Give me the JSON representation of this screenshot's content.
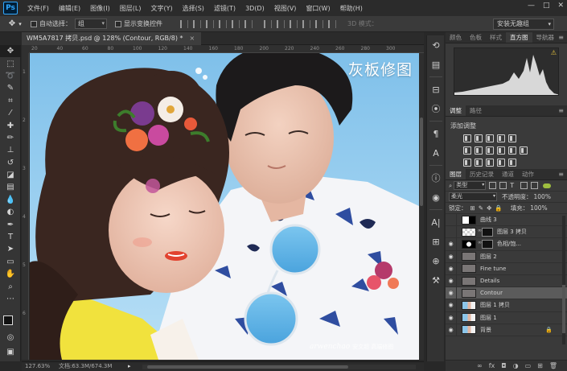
{
  "menubar": {
    "logo": "Ps",
    "items": [
      "文件(F)",
      "编辑(E)",
      "图像(I)",
      "图层(L)",
      "文字(Y)",
      "选择(S)",
      "滤镜(T)",
      "3D(D)",
      "视图(V)",
      "窗口(W)",
      "帮助(H)"
    ],
    "win_min": "—",
    "win_max": "□",
    "win_close": "✕"
  },
  "options": {
    "auto_select_label": "自动选择：",
    "auto_select_value": "组",
    "show_transform_label": "显示变换控件",
    "mode_3d_label": "3D 模式：",
    "workspace": "安装无趣组"
  },
  "document": {
    "tab_title": "WM5A7817 拷贝.psd @ 128% (Contour, RGB/8) *",
    "tab_close": "×",
    "canvas_title": "灰板修图",
    "watermark_en": "arwenchao",
    "watermark_cn": "安文超 高端修图",
    "ruler_ticks": [
      "20",
      "40",
      "60",
      "80",
      "100",
      "120",
      "140",
      "160",
      "180",
      "200",
      "220",
      "240",
      "260",
      "280",
      "300"
    ],
    "ruler_left_ticks": [
      "1",
      "2",
      "3",
      "4",
      "5",
      "6"
    ]
  },
  "status": {
    "zoom": "127.63%",
    "doc_size": "文档:63.3M/674.3M",
    "arrow": "▸"
  },
  "panels": {
    "top_tabs": [
      "颜色",
      "色板",
      "样式",
      "直方图",
      "导航器"
    ],
    "top_active": "直方图",
    "adj_tabs": [
      "调整",
      "路径"
    ],
    "adj_active": "调整",
    "adj_title": "添加调整",
    "layers_tabs": [
      "图层",
      "历史记录",
      "通道",
      "动作"
    ],
    "layers_active": "图层",
    "filter_select": "类型",
    "blend_mode": "柔光",
    "opacity_label": "不透明度：",
    "opacity_value": "100%",
    "lock_label": "锁定：",
    "fill_label": "填充：",
    "fill_value": "100%",
    "menu_icon": "≡"
  },
  "layers": [
    {
      "name": "曲线 3",
      "visible": false,
      "type": "adjust"
    },
    {
      "name": "图层 3 拷贝",
      "visible": false,
      "type": "image-mask"
    },
    {
      "name": "色相/饱...",
      "visible": true,
      "type": "adjust-mask"
    },
    {
      "name": "图层 2",
      "visible": true,
      "type": "gray"
    },
    {
      "name": "Fine tune",
      "visible": true,
      "type": "gray"
    },
    {
      "name": "Details",
      "visible": true,
      "type": "gray"
    },
    {
      "name": "Contour",
      "visible": true,
      "type": "gray",
      "selected": true
    },
    {
      "name": "图层 1 拷贝",
      "visible": true,
      "type": "photo"
    },
    {
      "name": "图层 1",
      "visible": true,
      "type": "photo"
    },
    {
      "name": "背景",
      "visible": true,
      "type": "photo",
      "locked": true
    }
  ],
  "icons": {
    "eye": "eye-icon",
    "lock": "lock-icon",
    "warning": "warning-icon"
  }
}
